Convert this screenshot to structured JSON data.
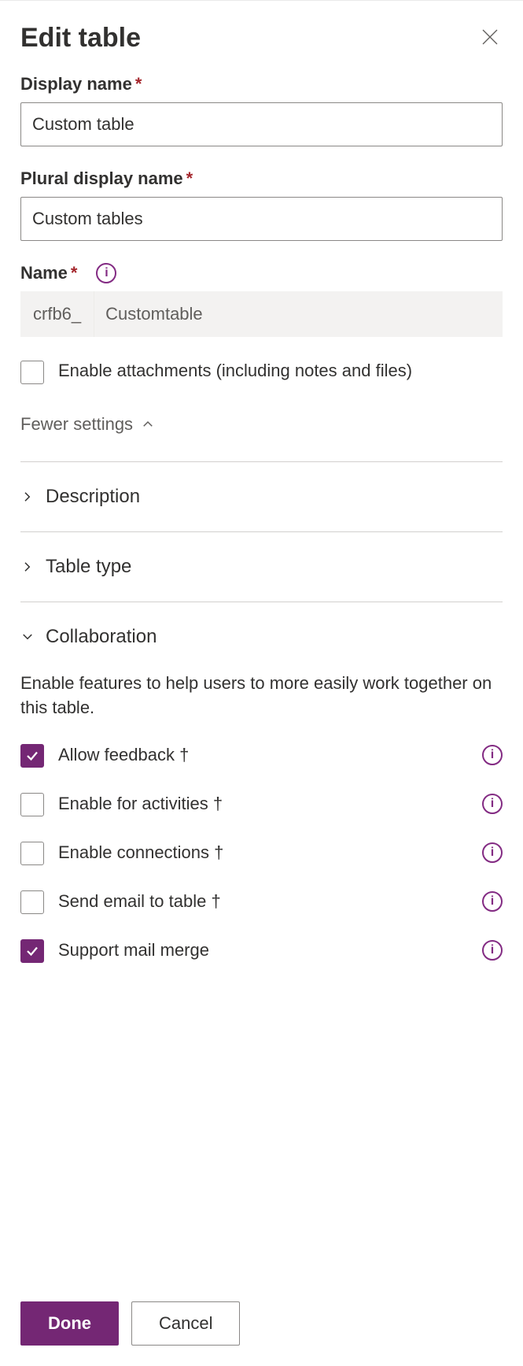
{
  "header": {
    "title": "Edit table"
  },
  "fields": {
    "display_name": {
      "label": "Display name",
      "value": "Custom table"
    },
    "plural_display_name": {
      "label": "Plural display name",
      "value": "Custom tables"
    },
    "name": {
      "label": "Name",
      "prefix": "crfb6_",
      "value": "Customtable"
    },
    "enable_attachments": {
      "label": "Enable attachments (including notes and files)",
      "checked": false
    }
  },
  "settings_toggle": "Fewer settings",
  "sections": {
    "description": {
      "title": "Description"
    },
    "table_type": {
      "title": "Table type"
    },
    "collaboration": {
      "title": "Collaboration",
      "description": "Enable features to help users to more easily work together on this table.",
      "items": [
        {
          "label": "Allow feedback †",
          "checked": true
        },
        {
          "label": "Enable for activities †",
          "checked": false
        },
        {
          "label": "Enable connections †",
          "checked": false
        },
        {
          "label": "Send email to table †",
          "checked": false
        },
        {
          "label": "Support mail merge",
          "checked": true
        }
      ]
    }
  },
  "footer": {
    "done": "Done",
    "cancel": "Cancel"
  }
}
